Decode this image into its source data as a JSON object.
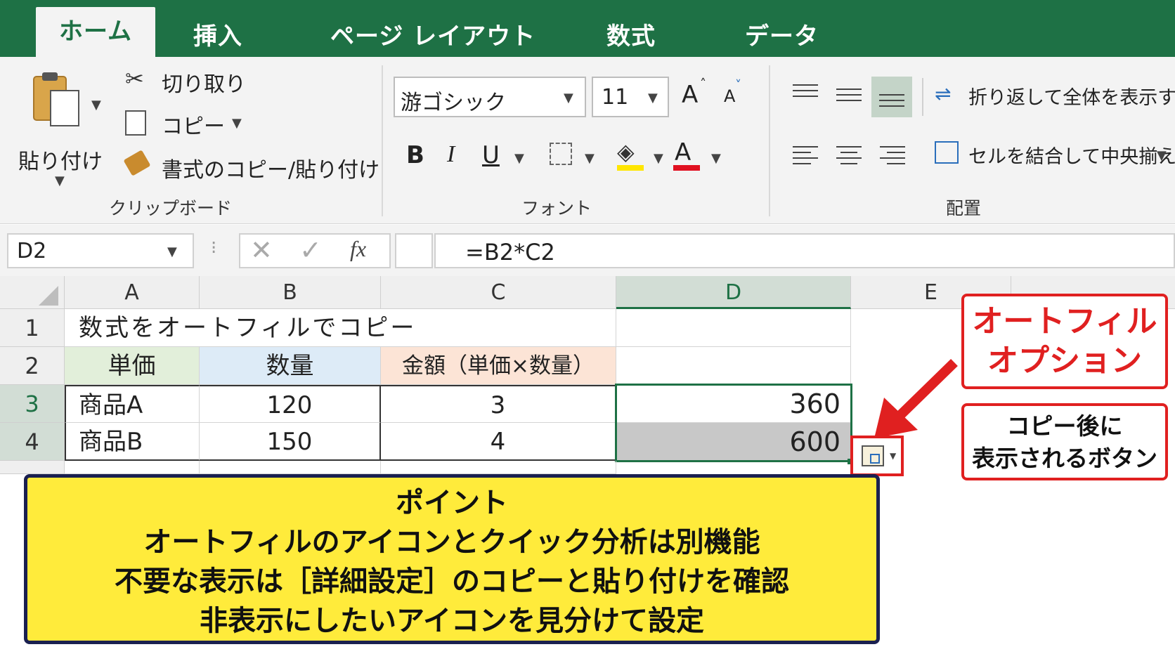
{
  "tabs": [
    "ホーム",
    "挿入",
    "ページ レイアウト",
    "数式",
    "データ"
  ],
  "clipboard": {
    "paste": "貼り付け",
    "cut": "切り取り",
    "copy": "コピー",
    "format_painter": "書式のコピー/貼り付け",
    "group_label": "クリップボード"
  },
  "font": {
    "font_name": "游ゴシック",
    "font_size": "11",
    "grow": "A",
    "shrink": "A",
    "bold": "B",
    "italic": "I",
    "underline": "U",
    "font_color_letter": "A",
    "group_label": "フォント",
    "highlight_color": "#ffe600",
    "font_color": "#e01020"
  },
  "alignment": {
    "wrap_text": "折り返して全体を表示する",
    "merge_center": "セルを結合して中央揃え",
    "group_label": "配置"
  },
  "formula_bar": {
    "name_box": "D2",
    "fx": "fx",
    "formula": "=B2*C2"
  },
  "sheet": {
    "columns": [
      "A",
      "B",
      "C",
      "D",
      "E"
    ],
    "rows": [
      "1",
      "2",
      "3",
      "4"
    ],
    "title": "数式をオートフィルでコピー",
    "headers": [
      "単価",
      "数量",
      "金額（単価×数量）"
    ],
    "data": [
      [
        "商品A",
        "120",
        "3",
        "360"
      ],
      [
        "商品B",
        "150",
        "4",
        "600"
      ]
    ]
  },
  "callouts": {
    "autofill_title_line1": "オートフィル",
    "autofill_title_line2": "オプション",
    "after_copy_line1": "コピー後に",
    "after_copy_line2": "表示されるボタン"
  },
  "point": {
    "heading": "ポイント",
    "lines": [
      "オートフィルのアイコンとクイック分析は別機能",
      "不要な表示は［詳細設定］のコピーと貼り付けを確認",
      "非表示にしたいアイコンを見分けて設定"
    ]
  },
  "colors": {
    "excel_green": "#1e7145",
    "header_green": "#e2efda",
    "header_blue": "#ddebf7",
    "header_peach": "#fce4d6",
    "accent_red": "#e02020",
    "point_yellow": "#ffeb3b"
  }
}
